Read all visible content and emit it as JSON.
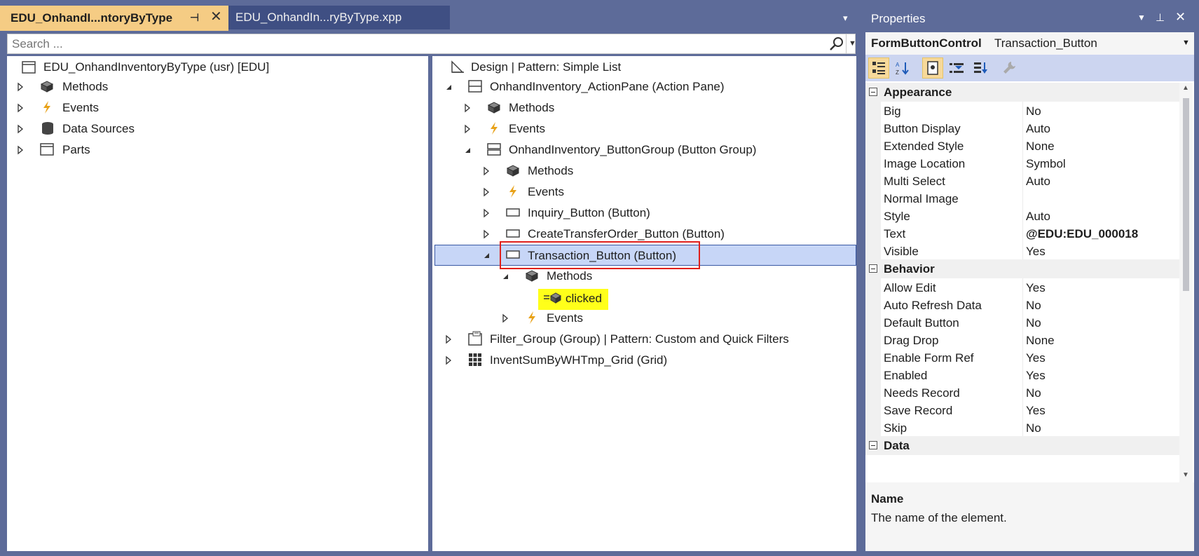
{
  "tabs": {
    "active": "EDU_OnhandI...ntoryByType",
    "pin_glyph": "⊣",
    "close_glyph": "✕",
    "second": "EDU_OnhandIn...ryByType.xpp",
    "dropdown_glyph": "▾"
  },
  "search": {
    "placeholder": "Search ..."
  },
  "left_tree": {
    "root": "EDU_OnhandInventoryByType (usr) [EDU]",
    "items": [
      "Methods",
      "Events",
      "Data Sources",
      "Parts"
    ]
  },
  "design_tree": {
    "root": "Design | Pattern: Simple List",
    "action_pane": "OnhandInventory_ActionPane (Action Pane)",
    "ap_methods": "Methods",
    "ap_events": "Events",
    "button_group": "OnhandInventory_ButtonGroup (Button Group)",
    "bg_methods": "Methods",
    "bg_events": "Events",
    "inquiry_button": "Inquiry_Button (Button)",
    "create_transfer_button": "CreateTransferOrder_Button (Button)",
    "transaction_button": "Transaction_Button (Button)",
    "tb_methods": "Methods",
    "tb_clicked": "clicked",
    "tb_events": "Events",
    "filter_group": "Filter_Group (Group) | Pattern: Custom and Quick Filters",
    "grid": "InventSumByWHTmp_Grid (Grid)"
  },
  "properties": {
    "title": "Properties",
    "object_type": "FormButtonControl",
    "object_name": "Transaction_Button",
    "categories": [
      {
        "name": "Appearance",
        "rows": [
          {
            "name": "Big",
            "value": "No"
          },
          {
            "name": "Button Display",
            "value": "Auto"
          },
          {
            "name": "Extended Style",
            "value": "None"
          },
          {
            "name": "Image Location",
            "value": "Symbol"
          },
          {
            "name": "Multi Select",
            "value": "Auto"
          },
          {
            "name": "Normal Image",
            "value": ""
          },
          {
            "name": "Style",
            "value": "Auto"
          },
          {
            "name": "Text",
            "value": "@EDU:EDU_000018",
            "bold": true
          },
          {
            "name": "Visible",
            "value": "Yes"
          }
        ]
      },
      {
        "name": "Behavior",
        "rows": [
          {
            "name": "Allow Edit",
            "value": "Yes"
          },
          {
            "name": "Auto Refresh Data",
            "value": "No"
          },
          {
            "name": "Default Button",
            "value": "No"
          },
          {
            "name": "Drag Drop",
            "value": "None"
          },
          {
            "name": "Enable Form Ref",
            "value": "Yes"
          },
          {
            "name": "Enabled",
            "value": "Yes"
          },
          {
            "name": "Needs Record",
            "value": "No"
          },
          {
            "name": "Save Record",
            "value": "Yes"
          },
          {
            "name": "Skip",
            "value": "No"
          }
        ]
      },
      {
        "name": "Data",
        "rows": []
      }
    ],
    "description_title": "Name",
    "description_text": "The name of the element."
  },
  "colors": {
    "selection": "#c7d6f7",
    "highlight": "#ffff1a",
    "annotation": "#e0201c",
    "active_tab": "#f5cc84",
    "chrome": "#5d6b99"
  }
}
